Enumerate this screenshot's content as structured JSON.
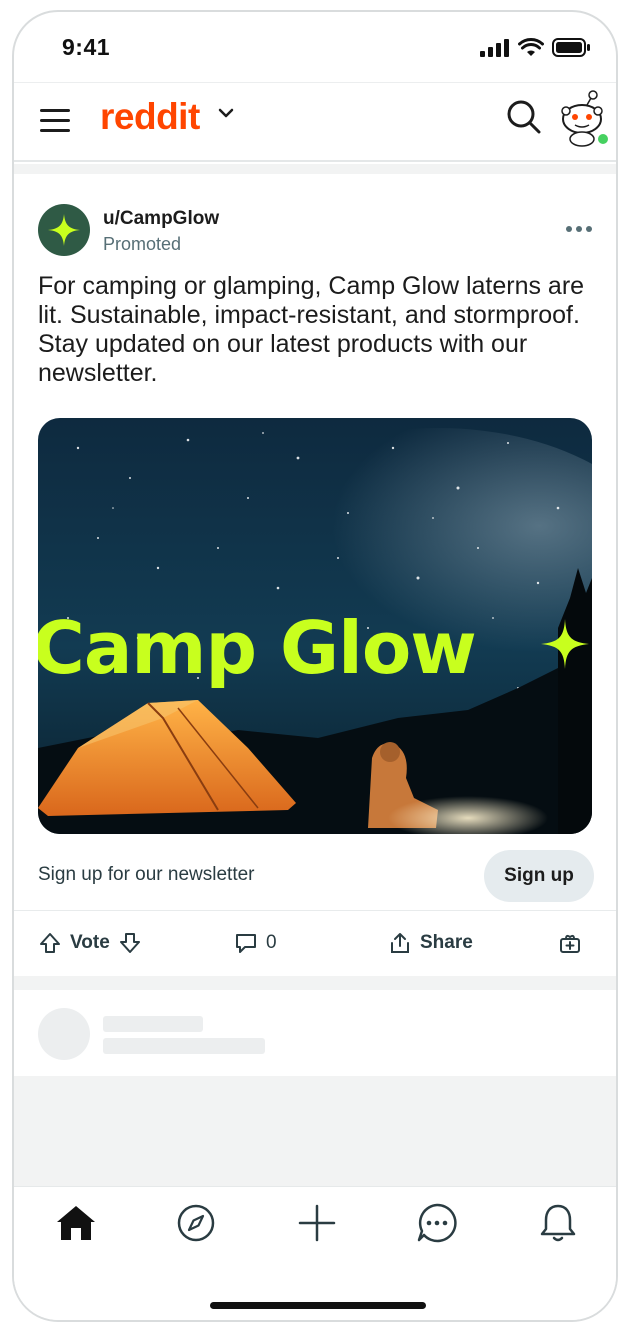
{
  "status_bar": {
    "time": "9:41"
  },
  "header": {
    "brand": "reddit"
  },
  "post": {
    "username": "u/CampGlow",
    "label": "Promoted",
    "title": "For camping or glamping, Camp Glow laterns are lit. Sustainable, impact-resistant, and stormproof. Stay updated on our latest products with our newsletter.",
    "media_headline": "Camp Glow",
    "cta_text": "Sign up for our newsletter",
    "cta_button": "Sign up",
    "vote_label": "Vote",
    "comment_count": "0",
    "share_label": "Share"
  },
  "colors": {
    "brand": "#ff4500",
    "accent_lime": "#c8ff1e",
    "avatar_green": "#2f5a45",
    "online_dot": "#46d160"
  },
  "icons": [
    "menu-icon",
    "chevron-down-icon",
    "search-icon",
    "snoo-avatar-icon",
    "more-icon",
    "upvote-icon",
    "downvote-icon",
    "comment-icon",
    "share-icon",
    "award-icon",
    "home-icon",
    "explore-icon",
    "create-icon",
    "chat-icon",
    "notification-icon"
  ]
}
